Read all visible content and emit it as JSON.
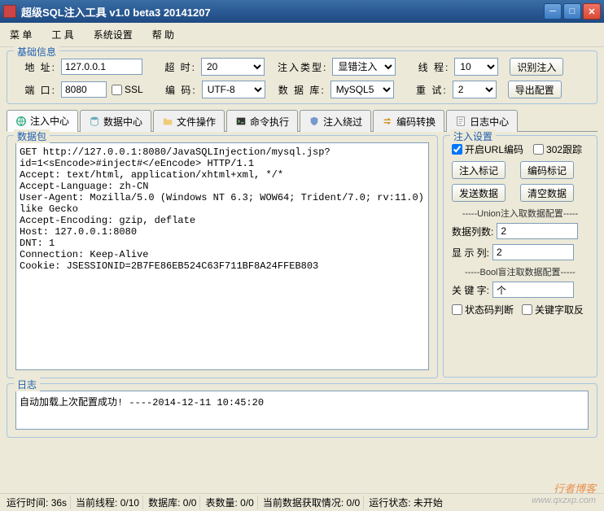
{
  "window": {
    "title": "超级SQL注入工具 v1.0 beta3 20141207"
  },
  "menu": {
    "items": [
      "菜 单",
      "工 具",
      "系统设置",
      "帮 助"
    ]
  },
  "basic": {
    "legend": "基础信息",
    "address_label": "地  址:",
    "address": "127.0.0.1",
    "timeout_label": "超  时:",
    "timeout": "20",
    "inject_type_label": "注入类型:",
    "inject_type": "显错注入",
    "threads_label": "线  程:",
    "threads": "10",
    "btn_recognize": "识别注入",
    "port_label": "端  口:",
    "port": "8080",
    "ssl_label": "SSL",
    "encoding_label": "编  码:",
    "encoding": "UTF-8",
    "database_label": "数 据 库:",
    "database": "MySQL5",
    "retry_label": "重  试:",
    "retry": "2",
    "btn_export": "导出配置"
  },
  "tabs": {
    "items": [
      "注入中心",
      "数据中心",
      "文件操作",
      "命令执行",
      "注入绕过",
      "编码转换",
      "日志中心"
    ]
  },
  "packet": {
    "legend": "数据包",
    "text": "GET http://127.0.0.1:8080/JavaSQLInjection/mysql.jsp?id=1<sEncode>#inject#</eEncode> HTTP/1.1\nAccept: text/html, application/xhtml+xml, */*\nAccept-Language: zh-CN\nUser-Agent: Mozilla/5.0 (Windows NT 6.3; WOW64; Trident/7.0; rv:11.0) like Gecko\nAccept-Encoding: gzip, deflate\nHost: 127.0.0.1:8080\nDNT: 1\nConnection: Keep-Alive\nCookie: JSESSIONID=2B7FE86EB524C63F711BF8A24FFEB803"
  },
  "settings": {
    "legend": "注入设置",
    "url_encode": "开启URL编码",
    "follow_302": "302跟踪",
    "btn_inject_mark": "注入标记",
    "btn_encode_mark": "编码标记",
    "btn_send": "发送数据",
    "btn_clear": "清空数据",
    "union_label": "-----Union注入取数据配置-----",
    "cols_label": "数据列数:",
    "cols": "2",
    "show_col_label": "显 示 列:",
    "show_col": "2",
    "bool_label": "-----Bool盲注取数据配置-----",
    "keyword_label": "关 键 字:",
    "keyword": "个",
    "status_judge": "状态码判断",
    "keyword_invert": "关键字取反"
  },
  "log": {
    "legend": "日志",
    "text": "自动加载上次配置成功! ----2014-12-11 10:45:20"
  },
  "status": {
    "runtime_label": "运行时间:",
    "runtime": "36s",
    "threads_label": "当前线程:",
    "threads": "0/10",
    "db_label": "数据库:",
    "db": "0/0",
    "tables_label": "表数量:",
    "tables": "0/0",
    "fetch_label": "当前数据获取情况:",
    "fetch": "0/0",
    "state_label": "运行状态:",
    "state": "未开始"
  },
  "watermark": {
    "name": "行者博客",
    "domain": "www.qxzxp.com"
  }
}
